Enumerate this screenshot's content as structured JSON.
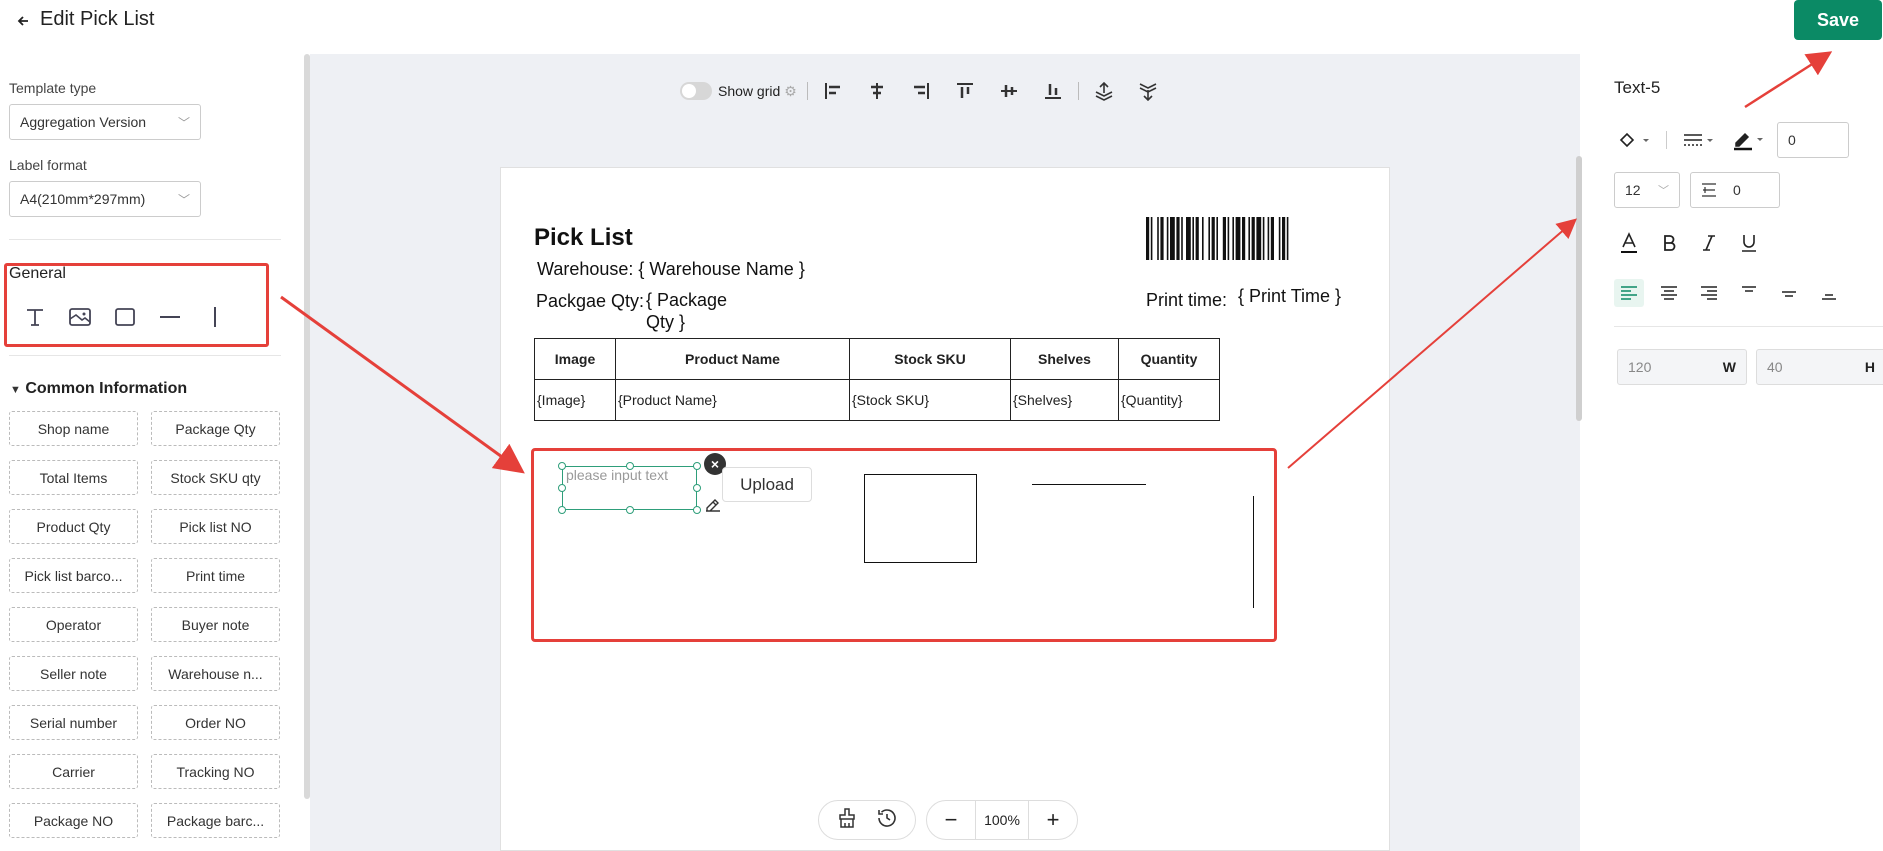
{
  "header": {
    "title": "Edit Pick List",
    "save_label": "Save"
  },
  "left": {
    "template_type_label": "Template type",
    "template_type_value": "Aggregation Version",
    "label_format_label": "Label format",
    "label_format_value": "A4(210mm*297mm)",
    "general_title": "General",
    "common_title": "Common Information",
    "common_items": [
      "Shop name",
      "Package Qty",
      "Total Items",
      "Stock SKU qty",
      "Product Qty",
      "Pick list NO",
      "Pick list barco...",
      "Print time",
      "Operator",
      "Buyer note",
      "Seller note",
      "Warehouse n...",
      "Serial number",
      "Order NO",
      "Carrier",
      "Tracking NO",
      "Package NO",
      "Package barc..."
    ]
  },
  "toolbar": {
    "show_grid_label": "Show grid"
  },
  "sheet": {
    "title": "Pick List",
    "warehouse_label": "Warehouse:",
    "warehouse_value": "{ Warehouse Name }",
    "package_qty_label": "Packgae Qty:",
    "package_qty_value_1": "{ Package",
    "package_qty_value_2": "Qty }",
    "print_time_label": "Print time:",
    "print_time_value": "{ Print Time }",
    "table_headers": [
      "Image",
      "Product Name",
      "Stock SKU",
      "Shelves",
      "Quantity"
    ],
    "table_row": [
      "{Image}",
      "{Product Name}",
      "{Stock SKU}",
      "{Shelves}",
      "{Quantity}"
    ],
    "text_placeholder": "please input text",
    "upload_label": "Upload"
  },
  "zoom": {
    "value": "100%"
  },
  "right": {
    "element_name": "Text-5",
    "border_width": "0",
    "font_size": "12",
    "line_spacing": "0",
    "width_value": "120",
    "width_label": "W",
    "height_value": "40",
    "height_label": "H"
  },
  "colors": {
    "accent": "#0b8a65",
    "highlight": "#e5403a"
  }
}
